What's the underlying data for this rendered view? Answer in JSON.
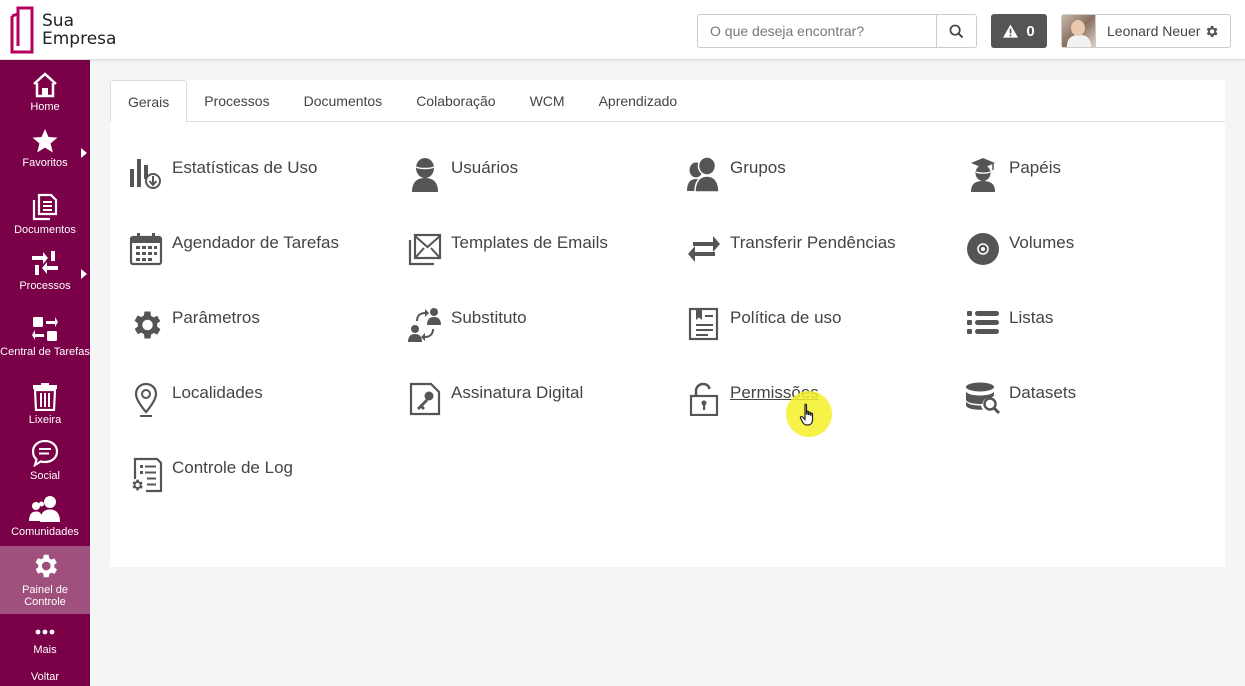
{
  "header": {
    "logo": {
      "line1": "Sua",
      "line2": "Empresa"
    },
    "search": {
      "placeholder": "O que deseja encontrar?",
      "icon": "search-icon"
    },
    "alerts": {
      "count": "0",
      "icon": "warning-icon"
    },
    "user": {
      "name": "Leonard Neuer",
      "icon": "gear-icon"
    }
  },
  "sidebar": {
    "items": [
      {
        "label": "Home",
        "icon": "home-icon"
      },
      {
        "label": "Favoritos",
        "icon": "star-icon",
        "has_submenu": true
      },
      {
        "label": "Documentos",
        "icon": "documents-icon"
      },
      {
        "label": "Processos",
        "icon": "processes-icon",
        "has_submenu": true
      },
      {
        "label": "Central de Tarefas",
        "icon": "task-central-icon"
      },
      {
        "label": "Lixeira",
        "icon": "trash-icon"
      },
      {
        "label": "Social",
        "icon": "chat-icon"
      },
      {
        "label": "Comunidades",
        "icon": "communities-icon"
      },
      {
        "label": "Painel de Controle",
        "icon": "gear-icon",
        "active": true
      },
      {
        "label": "Mais",
        "icon": "more-icon"
      },
      {
        "label": "Voltar",
        "icon": ""
      }
    ]
  },
  "tabs": [
    {
      "label": "Gerais",
      "active": true
    },
    {
      "label": "Processos"
    },
    {
      "label": "Documentos"
    },
    {
      "label": "Colaboração"
    },
    {
      "label": "WCM"
    },
    {
      "label": "Aprendizado"
    }
  ],
  "items": [
    {
      "label": "Estatísticas de Uso",
      "icon": "usage-stats-icon"
    },
    {
      "label": "Usuários",
      "icon": "user-icon"
    },
    {
      "label": "Grupos",
      "icon": "group-icon"
    },
    {
      "label": "Papéis",
      "icon": "graduate-icon"
    },
    {
      "label": "Agendador de Tarefas",
      "icon": "calendar-icon"
    },
    {
      "label": "Templates de Emails",
      "icon": "email-template-icon"
    },
    {
      "label": "Transferir Pendências",
      "icon": "transfer-icon"
    },
    {
      "label": "Volumes",
      "icon": "disc-icon"
    },
    {
      "label": "Parâmetros",
      "icon": "gear-icon"
    },
    {
      "label": "Substituto",
      "icon": "substitute-icon"
    },
    {
      "label": "Política de uso",
      "icon": "policy-icon"
    },
    {
      "label": "Listas",
      "icon": "list-icon"
    },
    {
      "label": "Localidades",
      "icon": "location-pin-icon"
    },
    {
      "label": "Assinatura Digital",
      "icon": "digital-signature-icon"
    },
    {
      "label": "Permissões",
      "icon": "unlock-icon",
      "hovered": true
    },
    {
      "label": "Datasets",
      "icon": "dataset-search-icon"
    },
    {
      "label": "Controle de Log",
      "icon": "log-control-icon"
    }
  ],
  "colors": {
    "sidebar": "#7a0047",
    "sidebar_active": "#a0507c",
    "logo": "#b5005e",
    "icon": "#555555"
  }
}
